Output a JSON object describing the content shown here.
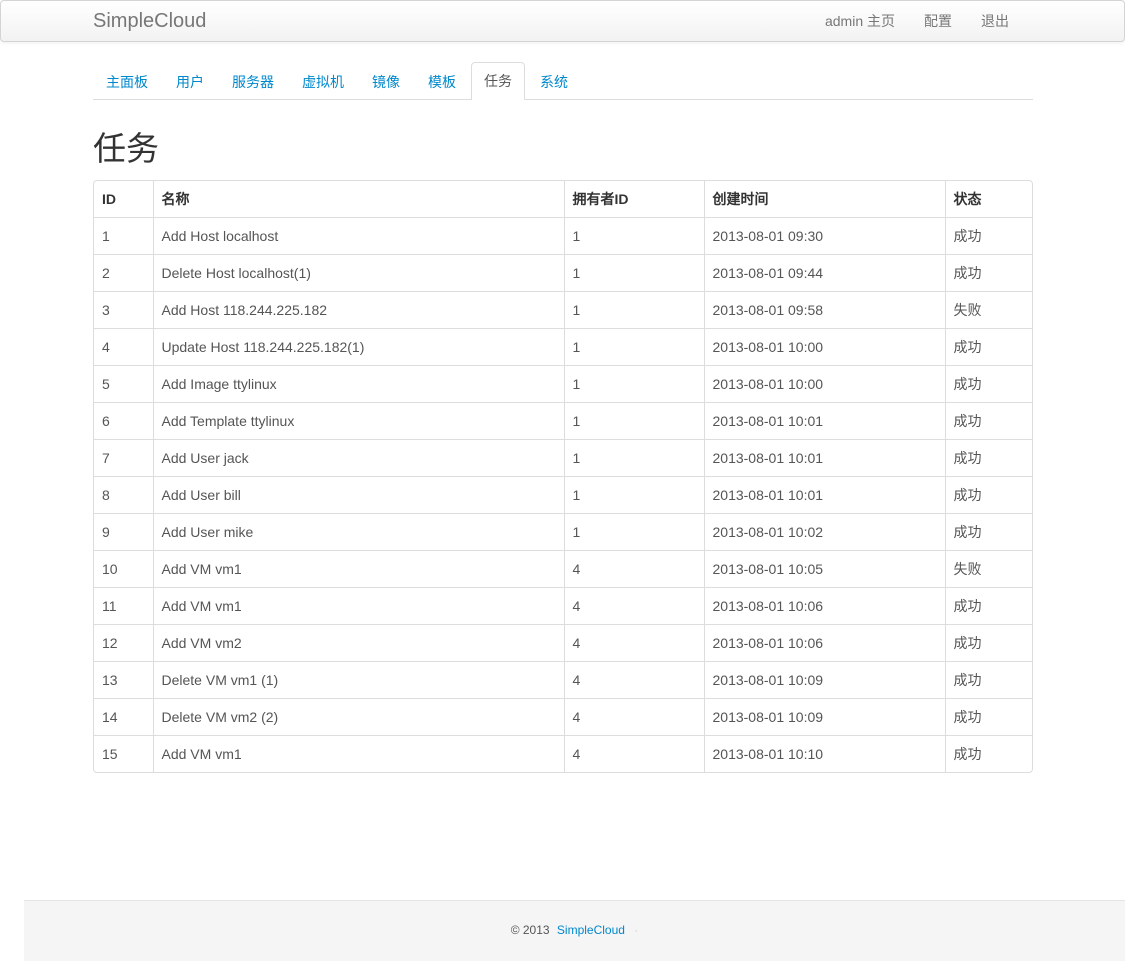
{
  "navbar": {
    "brand": "SimpleCloud",
    "links": [
      {
        "name": "home-link",
        "label": "admin 主页"
      },
      {
        "name": "settings-link",
        "label": "配置"
      },
      {
        "name": "logout-link",
        "label": "退出"
      }
    ]
  },
  "tabs": [
    {
      "name": "tab-dashboard",
      "label": "主面板",
      "active": false
    },
    {
      "name": "tab-users",
      "label": "用户",
      "active": false
    },
    {
      "name": "tab-servers",
      "label": "服务器",
      "active": false
    },
    {
      "name": "tab-vms",
      "label": "虚拟机",
      "active": false
    },
    {
      "name": "tab-images",
      "label": "镜像",
      "active": false
    },
    {
      "name": "tab-templates",
      "label": "模板",
      "active": false
    },
    {
      "name": "tab-tasks",
      "label": "任务",
      "active": true
    },
    {
      "name": "tab-system",
      "label": "系统",
      "active": false
    }
  ],
  "page_title": "任务",
  "table": {
    "headers": [
      "ID",
      "名称",
      "拥有者ID",
      "创建时间",
      "状态"
    ],
    "rows": [
      [
        "1",
        "Add Host localhost",
        "1",
        "2013-08-01 09:30",
        "成功"
      ],
      [
        "2",
        "Delete Host localhost(1)",
        "1",
        "2013-08-01 09:44",
        "成功"
      ],
      [
        "3",
        "Add Host 118.244.225.182",
        "1",
        "2013-08-01 09:58",
        "失败"
      ],
      [
        "4",
        "Update Host 118.244.225.182(1)",
        "1",
        "2013-08-01 10:00",
        "成功"
      ],
      [
        "5",
        "Add Image ttylinux",
        "1",
        "2013-08-01 10:00",
        "成功"
      ],
      [
        "6",
        "Add Template ttylinux",
        "1",
        "2013-08-01 10:01",
        "成功"
      ],
      [
        "7",
        "Add User jack",
        "1",
        "2013-08-01 10:01",
        "成功"
      ],
      [
        "8",
        "Add User bill",
        "1",
        "2013-08-01 10:01",
        "成功"
      ],
      [
        "9",
        "Add User mike",
        "1",
        "2013-08-01 10:02",
        "成功"
      ],
      [
        "10",
        "Add VM vm1",
        "4",
        "2013-08-01 10:05",
        "失败"
      ],
      [
        "11",
        "Add VM vm1",
        "4",
        "2013-08-01 10:06",
        "成功"
      ],
      [
        "12",
        "Add VM vm2",
        "4",
        "2013-08-01 10:06",
        "成功"
      ],
      [
        "13",
        "Delete VM vm1 (1)",
        "4",
        "2013-08-01 10:09",
        "成功"
      ],
      [
        "14",
        "Delete VM vm2 (2)",
        "4",
        "2013-08-01 10:09",
        "成功"
      ],
      [
        "15",
        "Add VM vm1",
        "4",
        "2013-08-01 10:10",
        "成功"
      ]
    ]
  },
  "footer": {
    "copyright": "© 2013",
    "link": "SimpleCloud",
    "separator": "·"
  }
}
